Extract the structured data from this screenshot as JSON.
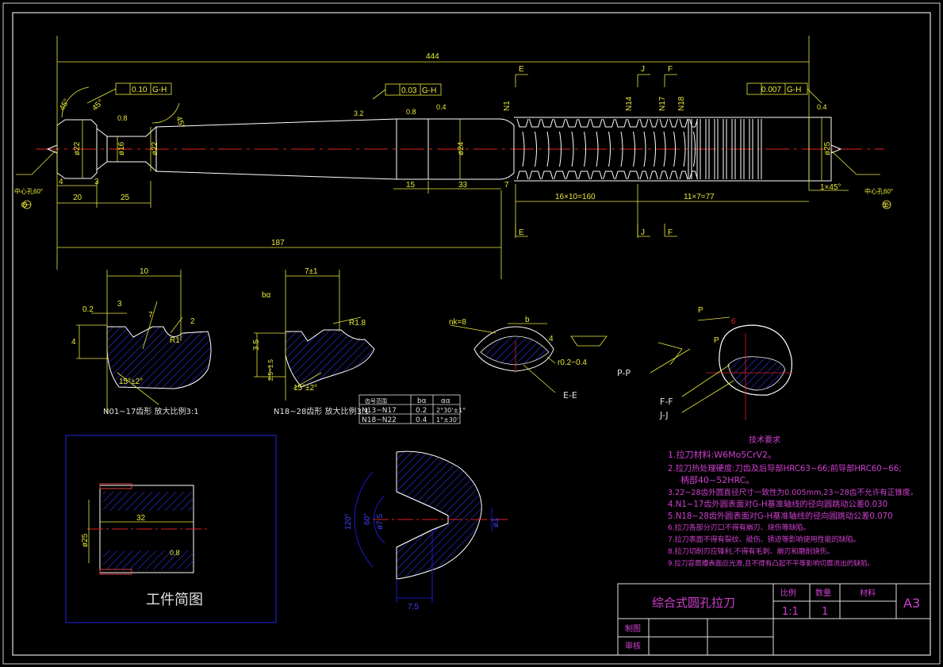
{
  "main_part": {
    "dims": {
      "overall_length": "444",
      "d_front": "ø22",
      "d_neck": "ø16",
      "d_shank": "ø22",
      "d_pilot": "ø24",
      "d_rear": "ø25",
      "l_20": "20",
      "l_25": "25",
      "l_4": "4",
      "l_3": "3",
      "l_15": "15",
      "l_33": "33",
      "l_7": "7",
      "l_187": "187",
      "pitch_rough": "16×10=160",
      "pitch_finish": "11×7=77",
      "chamfer_rear": "1×45°",
      "angle_45a": "45°",
      "angle_45b": "45°",
      "angle_45c": "45°",
      "center_hole_left": "中心孔60°",
      "center_hole_right": "中心孔60°",
      "runout_1": "0.10",
      "runout_1_ref": "G-H",
      "runout_2": "0.03",
      "runout_2_ref": "G-H",
      "runout_3": "0.007",
      "runout_3_ref": "G-H",
      "rough_08a": "0.8",
      "rough_08b": "0.8",
      "rough_08c": "0.8",
      "rough_32": "3.2",
      "rough_04": "0.4",
      "rough_04b": "0.4"
    },
    "section_marks": {
      "e_top": "E",
      "e_bot": "E",
      "j_top": "J",
      "j_bot": "J",
      "f_top": "F",
      "f_bot": "F",
      "g": "G",
      "h": "H"
    },
    "tooth_labels": [
      "N1",
      "N14",
      "N17",
      "N18"
    ]
  },
  "detail_views": {
    "detail1": {
      "caption": "N01~17齿形 放大比例3:1",
      "d10": "10",
      "d02": "0.2",
      "d3": "3",
      "d4": "4",
      "d2": "2",
      "d7": "7",
      "a15": "15°±2°",
      "r1": "R1"
    },
    "detail2": {
      "caption": "N18~28齿形 放大比例3:1",
      "d7pm1": "7±1",
      "d35": "3.5",
      "d25": "2.5~1.5",
      "r18": "R1.8",
      "a15": "15°±2°",
      "ba": "bα"
    },
    "detail3": {
      "nk": "nk=8",
      "b": "b",
      "r": "r0.2~0.4",
      "section": "E-E",
      "d4": "4"
    },
    "detail4": {
      "p1": "P",
      "p2": "P",
      "d6": "6",
      "pp": "P-P",
      "ff": "F-F",
      "jj": "J-J"
    }
  },
  "small_table": {
    "header": [
      "齿号范围",
      "bα",
      "αα"
    ],
    "rows": [
      [
        "N13~N17",
        "0.2",
        "2°30'±1°"
      ],
      [
        "N18~N22",
        "0.4",
        "1°±30'"
      ]
    ]
  },
  "workpiece": {
    "title": "工件简图",
    "dia": "ø25",
    "length": "32",
    "rough": "0.8"
  },
  "center_hole_view": {
    "a120": "120°",
    "a60": "60°",
    "d75": "ø7.5",
    "d3": "ø3",
    "l75": "7.5"
  },
  "tech_requirements": {
    "title": "技术要求",
    "items": [
      "1.拉刀材料:W6Mo5CrV2。",
      "2.拉刀热处理硬度:刀齿及后导部HRC63~66;前导部HRC60~66;",
      "柄部40~52HRC。",
      "3.22~28齿外圆直径尺寸一致性为0.005mm,23~28齿不允许有正锥度。",
      "4.N1~17齿外圆表面对G-H基准轴线的径向圆跳动公差0.030",
      "5.N18~28齿外圆表面对G-H基准轴线的径向圆跳动公差0.070",
      "6.拉刀各部分刃口不得有崩刃、烧伤等缺陷。",
      "7.拉刀表面不得有裂纹、碰伤、锈迹等影响使用性能的缺陷。",
      "8.拉刀切削刃应锋利,不得有毛刺、崩刃和磨削烧伤。",
      "9.拉刀容屑槽表面应光滑,且不得有凸起不平等影响切屑流出的缺陷。"
    ]
  },
  "title_block": {
    "name": "综合式圆孔拉刀",
    "scale_label": "比例",
    "qty_label": "数量",
    "material_label": "材料",
    "scale": "1:1",
    "qty": "1",
    "size": "A3",
    "drawn_label": "制图",
    "review_label": "审核"
  },
  "colors": {
    "background": "#000000",
    "geometry": "#ffffff",
    "dimension": "#e9e93a",
    "centerline": "#e02020",
    "hatch": "#3030e0",
    "text_magenta": "#d040d0",
    "frame_blue": "#2020c0"
  }
}
